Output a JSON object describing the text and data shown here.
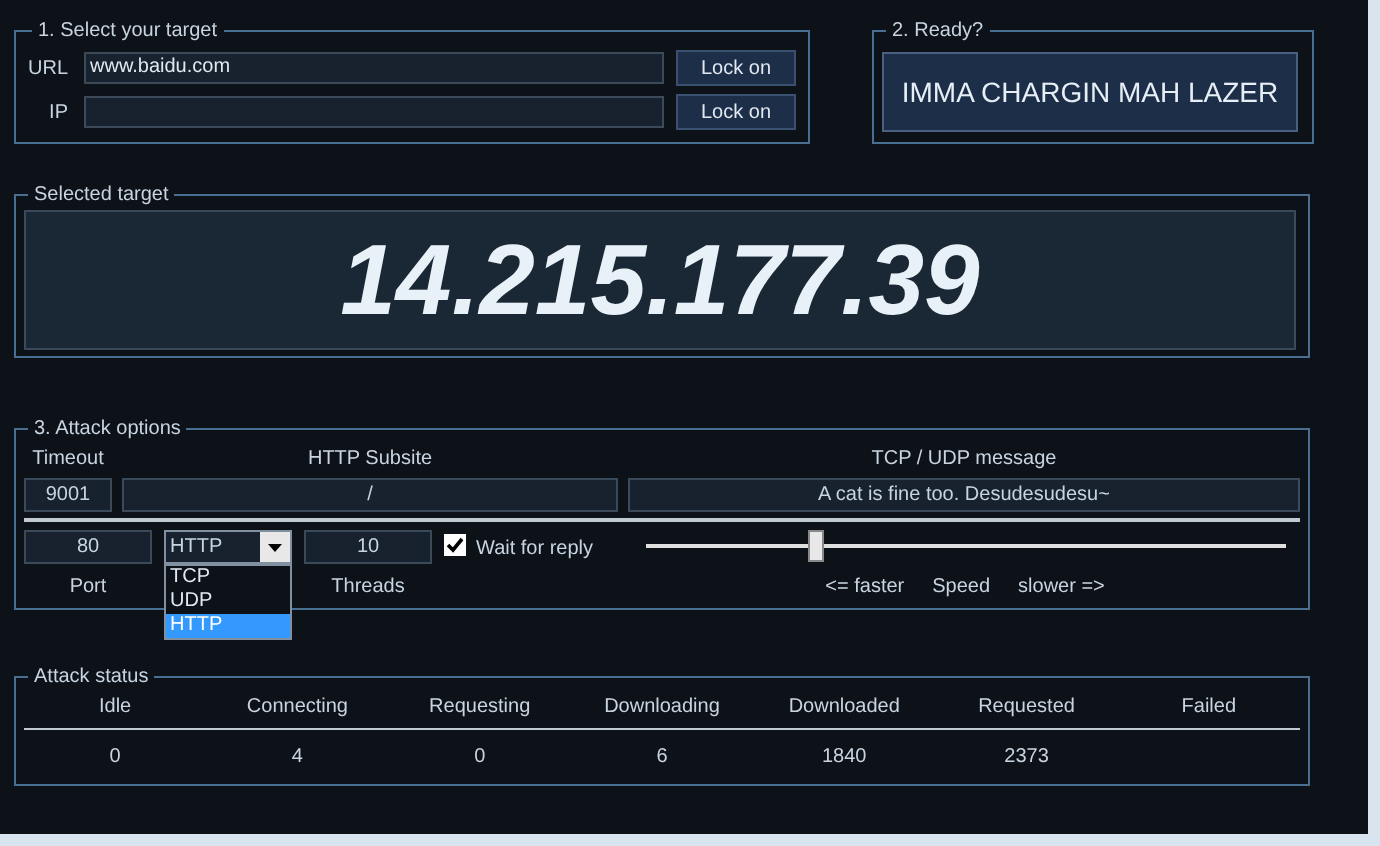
{
  "target_group": {
    "title": "1. Select your target",
    "url": {
      "label": "URL",
      "value": "www.baidu.com",
      "button": "Lock on"
    },
    "ip": {
      "label": "IP",
      "button": "Lock on"
    }
  },
  "ready_group": {
    "title": "2. Ready?",
    "button": "IMMA CHARGIN MAH LAZER"
  },
  "selected_target": {
    "title": "Selected target",
    "value": "14.215.177.39"
  },
  "attack_options": {
    "title": "3. Attack options",
    "timeout": {
      "label": "Timeout",
      "value": "9001"
    },
    "subsite": {
      "label": "HTTP Subsite",
      "value": "/"
    },
    "message": {
      "label": "TCP / UDP message",
      "value": "A cat is fine too. Desudesudesu~"
    },
    "port": {
      "label": "Port",
      "value": "80"
    },
    "method": {
      "value": "HTTP",
      "expanded": true,
      "options": [
        {
          "label": "TCP",
          "selected": false
        },
        {
          "label": "UDP",
          "selected": false
        },
        {
          "label": "HTTP",
          "selected": true
        }
      ]
    },
    "threads": {
      "label": "Threads",
      "value": "10"
    },
    "wait_for_reply": {
      "label": "Wait for reply",
      "checked": true
    },
    "speed": {
      "level": 0.26,
      "faster": "<= faster",
      "label": "Speed",
      "slower": "slower =>"
    }
  },
  "attack_status": {
    "title": "Attack status",
    "columns": [
      {
        "label": "Idle",
        "value": "0"
      },
      {
        "label": "Connecting",
        "value": "4"
      },
      {
        "label": "Requesting",
        "value": "0"
      },
      {
        "label": "Downloading",
        "value": "6"
      },
      {
        "label": "Downloaded",
        "value": "1840"
      },
      {
        "label": "Requested",
        "value": "2373"
      },
      {
        "label": "Failed"
      }
    ]
  }
}
